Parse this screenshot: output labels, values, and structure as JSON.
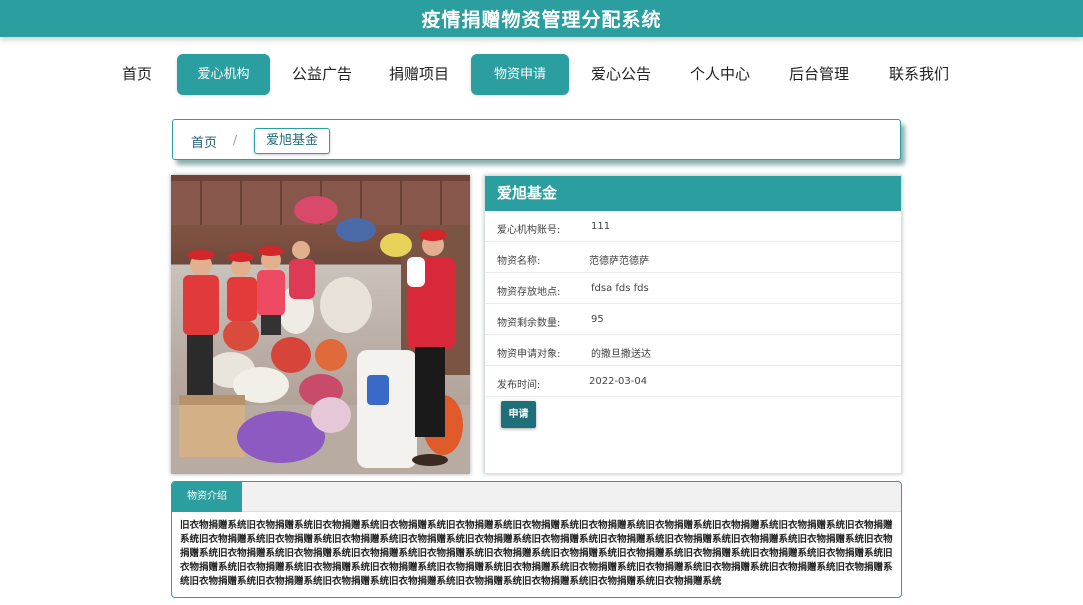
{
  "header": {
    "title": "疫情捐赠物资管理分配系统"
  },
  "nav": {
    "items": [
      {
        "label": "首页",
        "active": false
      },
      {
        "label": "爱心机构",
        "active": true
      },
      {
        "label": "公益广告",
        "active": false
      },
      {
        "label": "捐赠项目",
        "active": false
      },
      {
        "label": "物资申请",
        "active": true
      },
      {
        "label": "爱心公告",
        "active": false
      },
      {
        "label": "个人中心",
        "active": false
      },
      {
        "label": "后台管理",
        "active": false
      },
      {
        "label": "联系我们",
        "active": false
      }
    ]
  },
  "breadcrumb": {
    "home": "首页",
    "separator": "/",
    "current": "爱旭基金"
  },
  "detail": {
    "title": "爱旭基金",
    "fields": [
      {
        "label": "爱心机构账号:",
        "value": "111"
      },
      {
        "label": "物资名称:",
        "value": "范德萨范德萨"
      },
      {
        "label": "物资存放地点:",
        "value": "fdsa fds fds"
      },
      {
        "label": "物资剩余数量:",
        "value": "95"
      },
      {
        "label": "物资申请对象:",
        "value": "的撒旦撒送达"
      },
      {
        "label": "发布时间:",
        "value": "2022-03-04"
      }
    ],
    "apply_label": "申请"
  },
  "intro": {
    "tab_label": "物资介绍",
    "text": "旧衣物捐赠系统旧衣物捐赠系统旧衣物捐赠系统旧衣物捐赠系统旧衣物捐赠系统旧衣物捐赠系统旧衣物捐赠系统旧衣物捐赠系统旧衣物捐赠系统旧衣物捐赠系统旧衣物捐赠系统旧衣物捐赠系统旧衣物捐赠系统旧衣物捐赠系统旧衣物捐赠系统旧衣物捐赠系统旧衣物捐赠系统旧衣物捐赠系统旧衣物捐赠系统旧衣物捐赠系统旧衣物捐赠系统旧衣物捐赠系统旧衣物捐赠系统旧衣物捐赠系统旧衣物捐赠系统旧衣物捐赠系统旧衣物捐赠系统旧衣物捐赠系统旧衣物捐赠系统旧衣物捐赠系统旧衣物捐赠系统旧衣物捐赠系统旧衣物捐赠系统旧衣物捐赠系统旧衣物捐赠系统旧衣物捐赠系统旧衣物捐赠系统旧衣物捐赠系统旧衣物捐赠系统旧衣物捐赠系统旧衣物捐赠系统旧衣物捐赠系统旧衣物捐赠系统旧衣物捐赠系统旧衣物捐赠系统旧衣物捐赠系统旧衣物捐赠系统旧衣物捐赠系统旧衣物捐赠系统旧衣物捐赠系统旧衣物捐赠系统"
  },
  "colors": {
    "accent": "#2b9ea0",
    "button_dark": "#1f6f7a"
  }
}
